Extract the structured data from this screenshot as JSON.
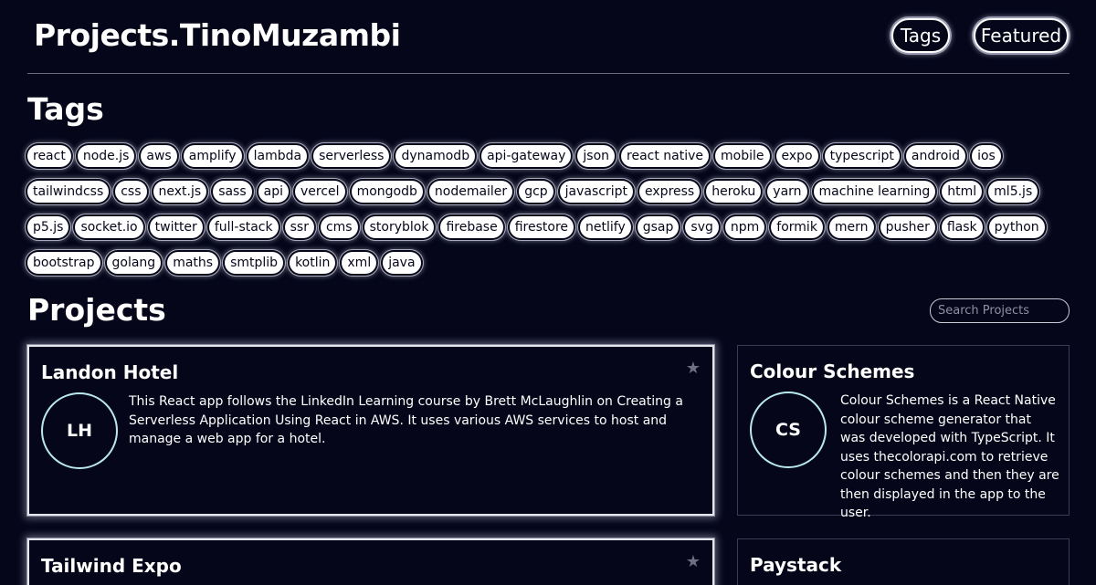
{
  "header": {
    "brand": "Projects.TinoMuzambi",
    "nav": {
      "tags": "Tags",
      "featured": "Featured"
    }
  },
  "tags_section": {
    "title": "Tags",
    "tags": [
      "react",
      "node.js",
      "aws",
      "amplify",
      "lambda",
      "serverless",
      "dynamodb",
      "api-gateway",
      "json",
      "react native",
      "mobile",
      "expo",
      "typescript",
      "android",
      "ios",
      "tailwindcss",
      "css",
      "next.js",
      "sass",
      "api",
      "vercel",
      "mongodb",
      "nodemailer",
      "gcp",
      "javascript",
      "express",
      "heroku",
      "yarn",
      "machine learning",
      "html",
      "ml5.js",
      "p5.js",
      "socket.io",
      "twitter",
      "full-stack",
      "ssr",
      "cms",
      "storyblok",
      "firebase",
      "firestore",
      "netlify",
      "gsap",
      "svg",
      "npm",
      "formik",
      "mern",
      "pusher",
      "flask",
      "python",
      "bootstrap",
      "golang",
      "maths",
      "smtplib",
      "kotlin",
      "xml",
      "java"
    ]
  },
  "projects_section": {
    "title": "Projects",
    "search_placeholder": "Search Projects",
    "projects": [
      {
        "title": "Landon Hotel",
        "initials": "LH",
        "description": "This React app follows the LinkedIn Learning course by Brett McLaughlin on Creating a Serverless Application Using React in AWS. It uses various AWS services to host and manage a web app for a hotel.",
        "star": "★"
      },
      {
        "title": "Colour Schemes",
        "initials": "CS",
        "description": "Colour Schemes is a React Native colour scheme generator that was developed with TypeScript. It uses thecolorapi.com to retrieve colour schemes and then they are then displayed in the app to the user."
      },
      {
        "title": "Tailwind Expo",
        "star": "★"
      },
      {
        "title": "Paystack"
      }
    ]
  },
  "colors": {
    "background": "#05061a",
    "tag_bg": "#ffffff",
    "avatar_ring": "#b9e8ec"
  }
}
